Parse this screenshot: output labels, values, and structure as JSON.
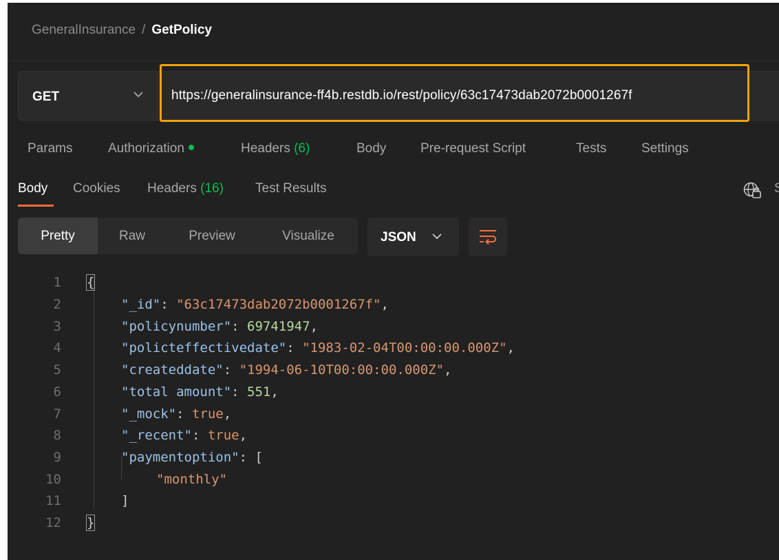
{
  "breadcrumb": {
    "collection": "GeneralInsurance",
    "separator": "/",
    "request": "GetPolicy"
  },
  "request": {
    "method": "GET",
    "url": "https://generalinsurance-ff4b.restdb.io/rest/policy/63c17473dab2072b0001267f"
  },
  "request_tabs": [
    {
      "label": "Params"
    },
    {
      "label": "Authorization"
    },
    {
      "label": "Headers",
      "count": "(6)"
    },
    {
      "label": "Body"
    },
    {
      "label": "Pre-request Script"
    },
    {
      "label": "Tests"
    },
    {
      "label": "Settings"
    }
  ],
  "response_tabs": [
    {
      "label": "Body"
    },
    {
      "label": "Cookies"
    },
    {
      "label": "Headers",
      "count": "(16)"
    },
    {
      "label": "Test Results"
    }
  ],
  "response_tabs_cut": "S",
  "format_buttons": [
    "Pretty",
    "Raw",
    "Preview",
    "Visualize"
  ],
  "format_select": "JSON",
  "line_numbers": [
    "1",
    "2",
    "3",
    "4",
    "5",
    "6",
    "7",
    "8",
    "9",
    "10",
    "11",
    "12"
  ],
  "json_body": {
    "open": "{",
    "close": "}",
    "id_key": "\"_id\"",
    "id_val": "\"63c17473dab2072b0001267f\"",
    "policynumber_key": "\"policynumber\"",
    "policynumber_val": "69741947",
    "effdate_key": "\"policteffectivedate\"",
    "effdate_val": "\"1983-02-04T00:00:00.000Z\"",
    "created_key": "\"createddate\"",
    "created_val": "\"1994-06-10T00:00:00.000Z\"",
    "total_key": "\"total amount\"",
    "total_val": "551",
    "mock_key": "\"_mock\"",
    "mock_val": "true",
    "recent_key": "\"_recent\"",
    "recent_val": "true",
    "payment_key": "\"paymentoption\"",
    "array_open": "[",
    "payment_item": "\"monthly\"",
    "array_close": "]"
  },
  "colors": {
    "accent_orange": "#f5a20c",
    "status_green": "#0cbb52",
    "tab_underline": "#ff6c37"
  },
  "icons": {
    "method_dropdown": "chevron-down-icon",
    "globe": "globe-lock-icon",
    "wrap": "wrap-lines-icon"
  }
}
